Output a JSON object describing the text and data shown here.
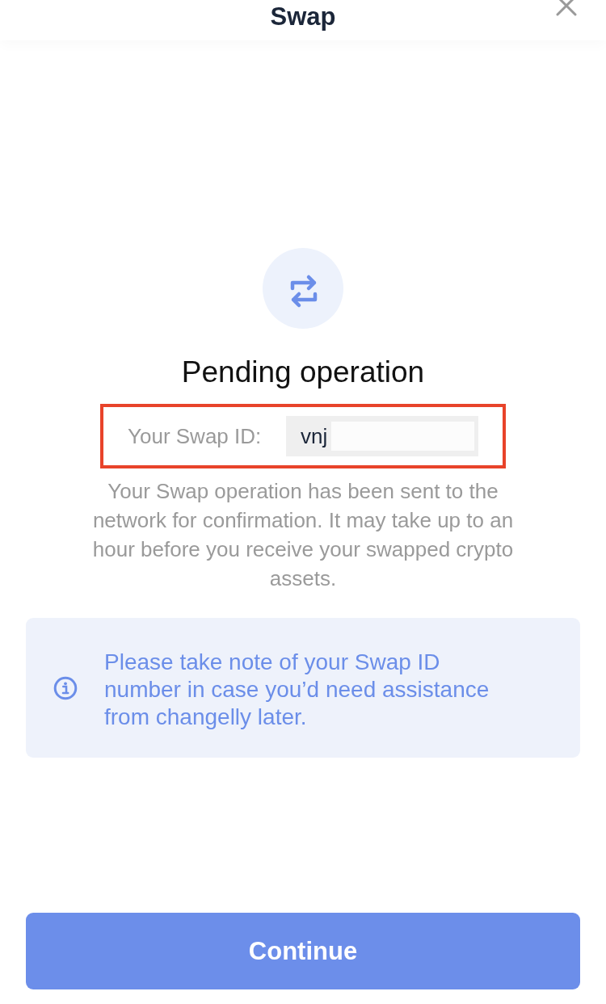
{
  "header": {
    "title": "Swap"
  },
  "status": {
    "title": "Pending operation",
    "highlighted": true,
    "id_label": "Your Swap ID:",
    "id_value": "vnj",
    "id_redacted": true,
    "description": "Your Swap operation has been sent to the network for confirmation. It may take up to an hour before you receive your swapped crypto assets."
  },
  "notice": {
    "text": "Please take note of your Swap ID number in case you’d need assistance from changelly later."
  },
  "buttons": [
    {
      "label": "Continue"
    }
  ]
}
